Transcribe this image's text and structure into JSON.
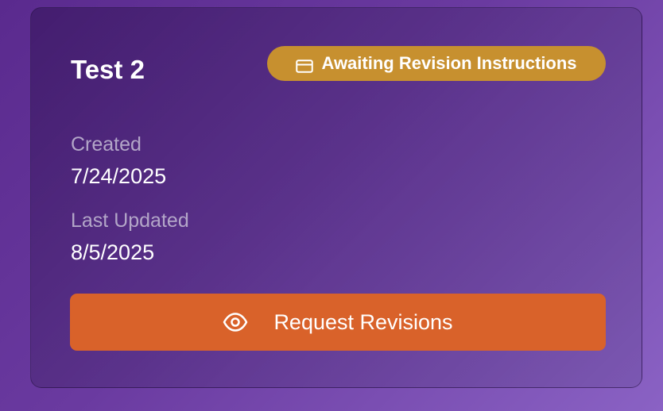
{
  "card": {
    "title": "Test 2",
    "status": {
      "label": "Awaiting Revision Instructions",
      "icon": "credit-card-icon",
      "color": "#c7902f"
    },
    "created": {
      "label": "Created",
      "value": "7/24/2025"
    },
    "updated": {
      "label": "Last Updated",
      "value": "8/5/2025"
    },
    "action": {
      "label": "Request Revisions",
      "icon": "eye-icon",
      "color": "#d9622a"
    }
  }
}
